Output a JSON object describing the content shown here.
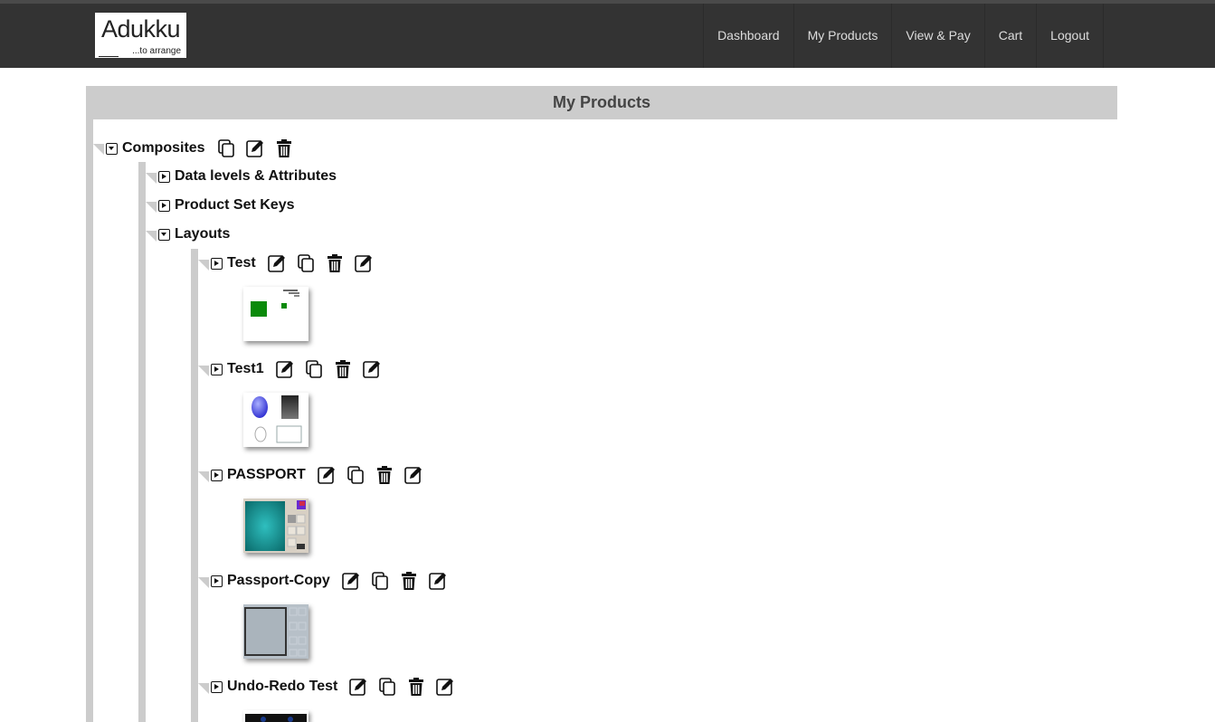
{
  "brand": {
    "logo_title": "Adukku",
    "logo_sub": "...to arrange"
  },
  "nav": {
    "items": [
      {
        "label": "Dashboard"
      },
      {
        "label": "My Products"
      },
      {
        "label": "View & Pay"
      },
      {
        "label": "Cart"
      },
      {
        "label": "Logout"
      }
    ]
  },
  "page": {
    "title": "My Products"
  },
  "tree": {
    "root": {
      "label": "Composites",
      "icons": [
        "copy-icon",
        "edit-icon",
        "trash-icon"
      ]
    },
    "children": [
      {
        "label": "Data levels & Attributes",
        "expanded": false
      },
      {
        "label": "Product Set Keys",
        "expanded": false
      },
      {
        "label": "Layouts",
        "expanded": true
      }
    ],
    "layouts": [
      {
        "label": "Test",
        "icons": [
          "edit-icon",
          "copy-icon",
          "trash-icon",
          "edit-icon"
        ]
      },
      {
        "label": "Test1",
        "icons": [
          "edit-icon",
          "copy-icon",
          "trash-icon",
          "edit-icon"
        ]
      },
      {
        "label": "PASSPORT",
        "icons": [
          "edit-icon",
          "copy-icon",
          "trash-icon",
          "edit-icon"
        ]
      },
      {
        "label": "Passport-Copy",
        "icons": [
          "edit-icon",
          "copy-icon",
          "trash-icon",
          "edit-icon"
        ]
      },
      {
        "label": "Undo-Redo Test",
        "icons": [
          "edit-icon",
          "copy-icon",
          "trash-icon",
          "edit-icon"
        ]
      }
    ]
  },
  "colors": {
    "navbar": "#333333",
    "panel_header": "#cccccc",
    "nav_text": "#dddddd",
    "tree_text": "#111111"
  }
}
